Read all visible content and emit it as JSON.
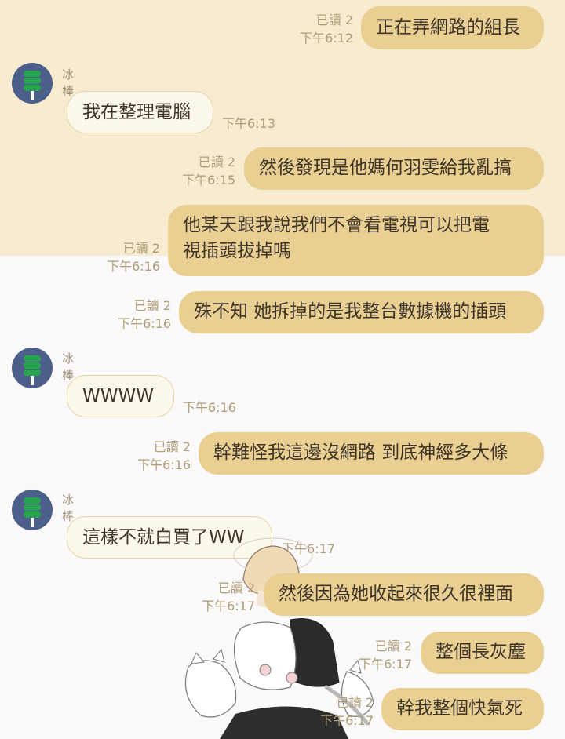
{
  "contact": {
    "name": "冰棒",
    "accent": "#4C5F8A"
  },
  "colors": {
    "top_background": "#F7ECD0",
    "bottom_background": "#FBF9F9",
    "outgoing_bubble": "#E9CF92",
    "incoming_bubble": "#FDF8EC"
  },
  "messages": [
    {
      "direction": "out",
      "text": "正在弄網路的組長",
      "read": "已讀 2",
      "time": "下午6:12"
    },
    {
      "direction": "in",
      "sender": "冰棒",
      "text": "我在整理電腦",
      "time": "下午6:13"
    },
    {
      "direction": "out",
      "text": "然後發現是他媽何羽雯給我亂搞",
      "read": "已讀 2",
      "time": "下午6:15"
    },
    {
      "direction": "out",
      "line1": "他某天跟我說我們不會看電視可以把電",
      "line2": "視插頭拔掉嗎",
      "read": "已讀 2",
      "time": "下午6:16"
    },
    {
      "direction": "out",
      "text": "殊不知 她拆掉的是我整台數據機的插頭",
      "read": "已讀 2",
      "time": "下午6:16"
    },
    {
      "direction": "in",
      "sender": "冰棒",
      "text": "WWWW",
      "time": "下午6:16"
    },
    {
      "direction": "out",
      "text": "幹難怪我這邊沒網路 到底神經多大條",
      "read": "已讀 2",
      "time": "下午6:16"
    },
    {
      "direction": "in",
      "sender": "冰棒",
      "text": "這樣不就白買了WW",
      "time": "下午6:17"
    },
    {
      "direction": "out",
      "text": "然後因為她收起來很久很裡面",
      "read": "已讀 2",
      "time": "下午6:17"
    },
    {
      "direction": "out",
      "text": "整個長灰塵",
      "read": "已讀 2",
      "time": "下午6:17"
    },
    {
      "direction": "out",
      "text": "幹我整個快氣死",
      "read": "已讀 2",
      "time": "下午6:17"
    }
  ]
}
